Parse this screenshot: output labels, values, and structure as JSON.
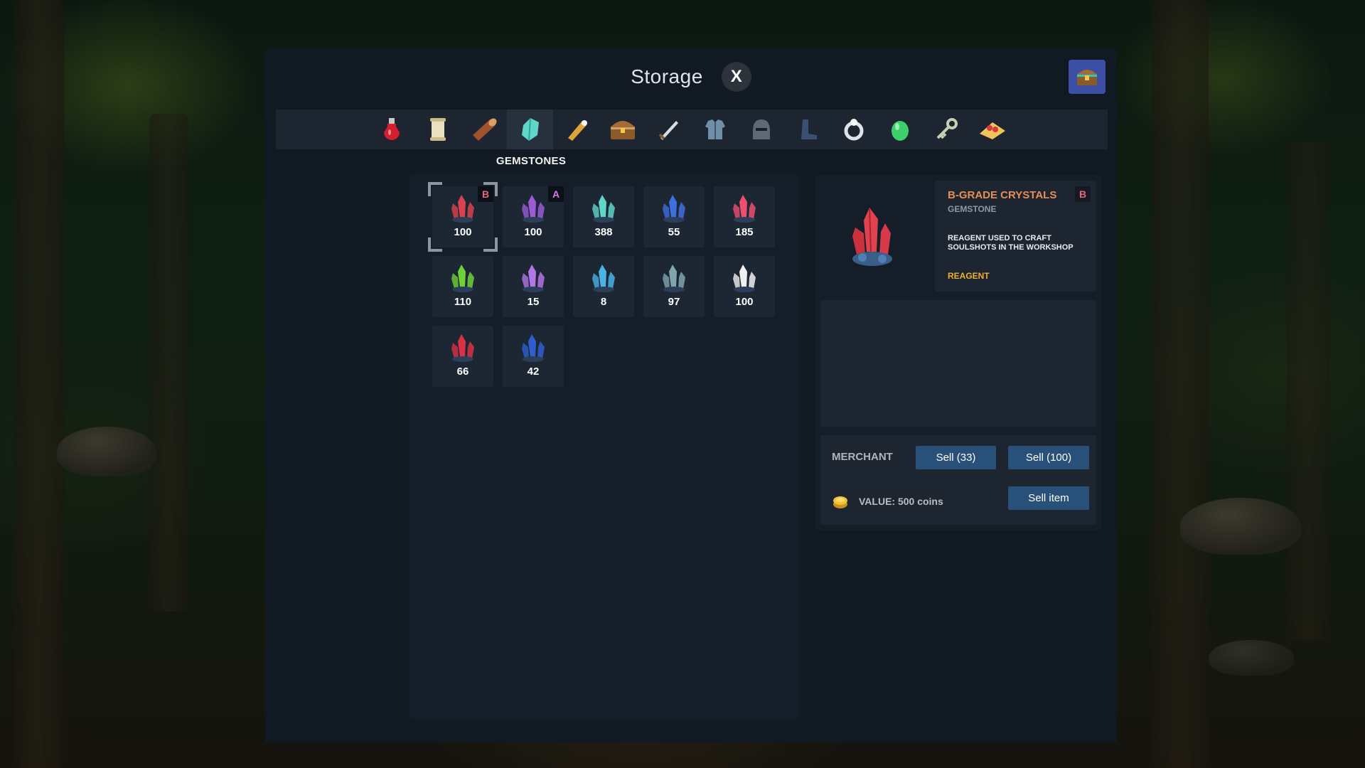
{
  "window": {
    "title": "Storage",
    "close_label": "X"
  },
  "categories": [
    {
      "icon": "potion-icon",
      "active": false
    },
    {
      "icon": "scroll-icon",
      "active": false
    },
    {
      "icon": "log-icon",
      "active": false
    },
    {
      "icon": "gemstone-icon",
      "active": true
    },
    {
      "icon": "tube-icon",
      "active": false
    },
    {
      "icon": "chest-icon",
      "active": false
    },
    {
      "icon": "sword-icon",
      "active": false
    },
    {
      "icon": "armor-icon",
      "active": false
    },
    {
      "icon": "helmet-icon",
      "active": false
    },
    {
      "icon": "boots-icon",
      "active": false
    },
    {
      "icon": "ring-icon",
      "active": false
    },
    {
      "icon": "egg-icon",
      "active": false
    },
    {
      "icon": "key-icon",
      "active": false
    },
    {
      "icon": "food-icon",
      "active": false
    }
  ],
  "category_label": "GEMSTONES",
  "items": [
    {
      "qty": "100",
      "grade": "B",
      "color": "#d9424f",
      "selected": true
    },
    {
      "qty": "100",
      "grade": "A",
      "color": "#9b5bd6",
      "selected": false
    },
    {
      "qty": "388",
      "grade": "",
      "color": "#5fd6c8",
      "selected": false
    },
    {
      "qty": "55",
      "grade": "",
      "color": "#3e6fe0",
      "selected": false
    },
    {
      "qty": "185",
      "grade": "",
      "color": "#ef4f6f",
      "selected": false
    },
    {
      "qty": "110",
      "grade": "",
      "color": "#6fd13a",
      "selected": false
    },
    {
      "qty": "15",
      "grade": "",
      "color": "#b176e8",
      "selected": false
    },
    {
      "qty": "8",
      "grade": "",
      "color": "#4ab3e6",
      "selected": false
    },
    {
      "qty": "97",
      "grade": "",
      "color": "#7fa6b0",
      "selected": false
    },
    {
      "qty": "100",
      "grade": "",
      "color": "#f0f0f0",
      "selected": false
    },
    {
      "qty": "66",
      "grade": "",
      "color": "#d83246",
      "selected": false
    },
    {
      "qty": "42",
      "grade": "",
      "color": "#2f5fcf",
      "selected": false
    }
  ],
  "detail": {
    "name": "B-GRADE CRYSTALS",
    "type": "GEMSTONE",
    "grade": "B",
    "description": "REAGENT USED TO CRAFT SOULSHOTS IN THE WORKSHOP",
    "tag": "REAGENT"
  },
  "merchant": {
    "label": "MERCHANT",
    "sell_some": "Sell (33)",
    "sell_all": "Sell (100)",
    "value_text": "VALUE:  500 coins",
    "sell_item": "Sell item"
  },
  "colors": {
    "accent_orange": "#e98d58",
    "tag_yellow": "#f0b02e",
    "button_blue": "#295078"
  }
}
